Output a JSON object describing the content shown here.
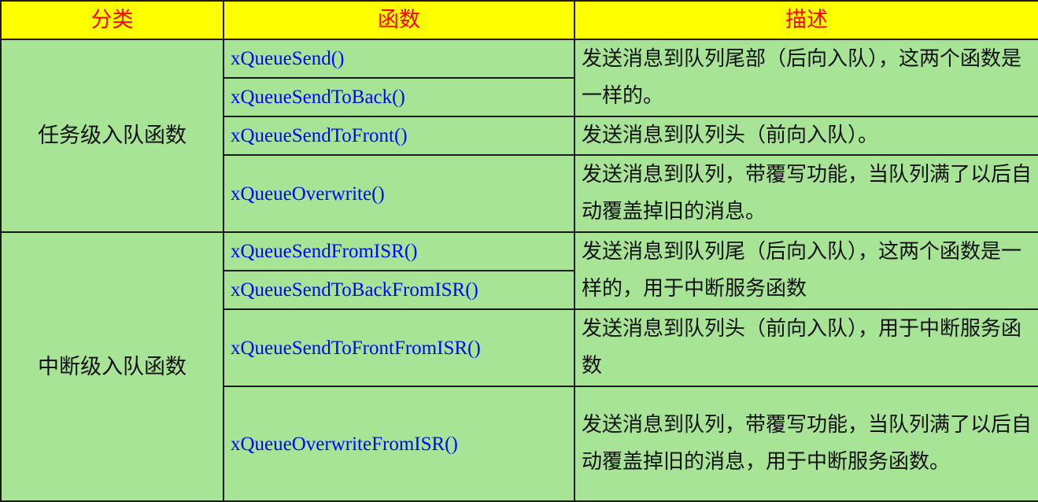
{
  "header": {
    "category": "分类",
    "function": "函数",
    "description": "描述"
  },
  "groups": [
    {
      "category": "任务级入队函数",
      "functions": [
        "xQueueSend()",
        "xQueueSendToBack()",
        "xQueueSendToFront()",
        "xQueueOverwrite()"
      ],
      "descriptions": [
        "发送消息到队列尾部（后向入队），这两个函数是一样的。",
        "发送消息到队列头（前向入队）。",
        "发送消息到队列，带覆写功能，当队列满了以后自动覆盖掉旧的消息。"
      ]
    },
    {
      "category": "中断级入队函数",
      "functions": [
        "xQueueSendFromISR()",
        "xQueueSendToBackFromISR()",
        "xQueueSendToFrontFromISR()",
        "xQueueOverwriteFromISR()"
      ],
      "descriptions": [
        "发送消息到队列尾（后向入队），这两个函数是一样的，用于中断服务函数",
        "发送消息到队列头（前向入队），用于中断服务函数",
        "发送消息到队列，带覆写功能，当队列满了以后自动覆盖掉旧的消息，用于中断服务函数。"
      ]
    }
  ]
}
